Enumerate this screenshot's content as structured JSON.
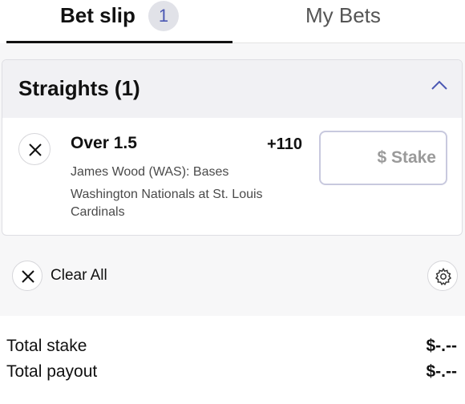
{
  "tabs": {
    "bet_slip": {
      "label": "Bet slip",
      "count": "1"
    },
    "my_bets": {
      "label": "My Bets"
    }
  },
  "card": {
    "title": "Straights (1)",
    "selection": {
      "name": "Over 1.5",
      "odds": "+110",
      "market": "James Wood (WAS): Bases",
      "event": "Washington Nationals at St. Louis Cardinals",
      "stake_placeholder": "$ Stake",
      "stake_value": ""
    }
  },
  "actions": {
    "clear_all": "Clear All"
  },
  "totals": {
    "stake_label": "Total stake",
    "stake_value": "$-.--",
    "payout_label": "Total payout",
    "payout_value": "$-.--"
  },
  "colors": {
    "accent": "#4b58b3",
    "badge_bg": "#e1e2e8",
    "header_bg": "#f1f1f4"
  },
  "icons": {
    "remove": "close-icon",
    "collapse": "chevron-up-icon",
    "clear": "close-icon",
    "settings": "gear-icon"
  }
}
